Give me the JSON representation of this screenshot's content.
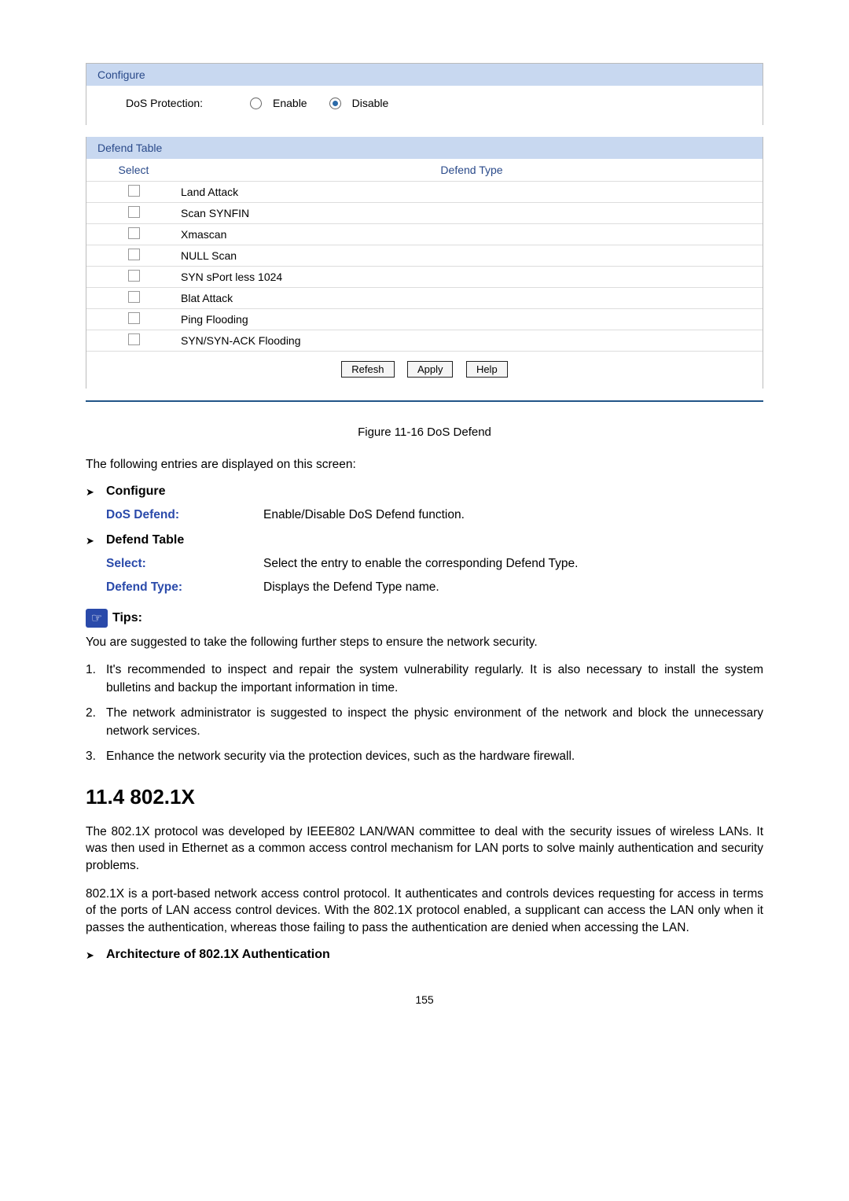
{
  "configure": {
    "header": "Configure",
    "dos_label": "DoS Protection:",
    "enable": "Enable",
    "disable": "Disable",
    "selected": "disable"
  },
  "defend": {
    "header": "Defend Table",
    "col_select": "Select",
    "col_type": "Defend Type",
    "rows": [
      "Land Attack",
      "Scan SYNFIN",
      "Xmascan",
      "NULL Scan",
      "SYN sPort less 1024",
      "Blat Attack",
      "Ping Flooding",
      "SYN/SYN-ACK Flooding"
    ],
    "btn_refresh": "Refesh",
    "btn_apply": "Apply",
    "btn_help": "Help"
  },
  "figcap": "Figure 11-16 DoS Defend",
  "intro": "The following entries are displayed on this screen:",
  "sec_configure": {
    "title": "Configure",
    "term": "DoS Defend:",
    "def": "Enable/Disable DoS Defend function."
  },
  "sec_defend": {
    "title": "Defend Table",
    "term1": "Select:",
    "def1": "Select the entry to enable the corresponding Defend Type.",
    "term2": "Defend Type:",
    "def2": "Displays the Defend Type name."
  },
  "tips": {
    "label": "Tips:",
    "intro": "You are suggested to take the following further steps to ensure the network security.",
    "items": [
      "It's recommended to inspect and repair the system vulnerability regularly. It is also necessary to install the system bulletins and backup the important information in time.",
      "The network administrator is suggested to inspect the physic environment of the network and block the unnecessary network services.",
      "Enhance the network security via the protection devices, such as the hardware firewall."
    ]
  },
  "sec8021x": {
    "title": "11.4 802.1X",
    "p1": "The 802.1X protocol was developed by IEEE802 LAN/WAN committee to deal with the security issues of wireless LANs. It was then used in Ethernet as a common access control mechanism for LAN ports to solve mainly authentication and security problems.",
    "p2": "802.1X is a port-based network access control protocol. It authenticates and controls devices requesting for access in terms of the ports of LAN access control devices. With the 802.1X protocol enabled, a supplicant can access the LAN only when it passes the authentication, whereas those failing to pass the authentication are denied when accessing the LAN.",
    "arch": "Architecture of 802.1X Authentication"
  },
  "pagenum": "155"
}
